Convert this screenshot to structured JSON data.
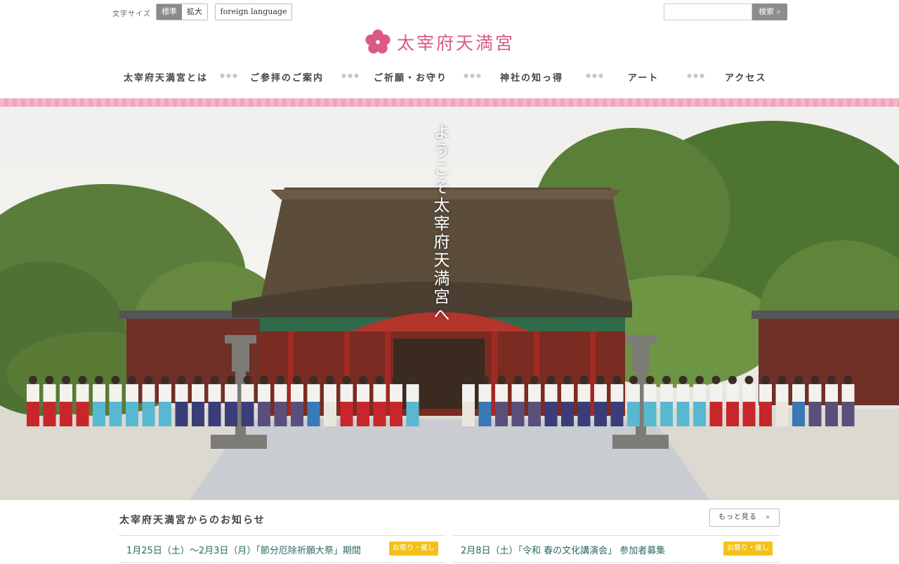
{
  "header": {
    "font_size_label": "文字サイズ",
    "font_size_options": [
      "標準",
      "拡大"
    ],
    "foreign_language_label": "foreign language",
    "search_placeholder": "",
    "search_button_label": "検索"
  },
  "logo": {
    "name": "太宰府天満宮",
    "color": "#d95b83"
  },
  "nav": {
    "items": [
      "太宰府天満宮とは",
      "ご参拝のご案内",
      "ご祈願・お守り",
      "神社の知っ得",
      "アート",
      "アクセス"
    ]
  },
  "hero": {
    "caption": "ようこそ太宰府天満宮へ"
  },
  "news": {
    "heading": "太宰府天満宮からのお知らせ",
    "more_label": "もっと見る",
    "items": [
      {
        "text": "1月25日（土）～2月3日（月）「節分厄除祈願大祭」期間",
        "tag": "お祭り・催し"
      },
      {
        "text": "2月8日（土）「令和 春の文化講演会」 参加者募集",
        "tag": "お祭り・催し"
      }
    ]
  },
  "colors": {
    "accent_pink": "#f4b6c9",
    "tag_yellow": "#f2c21b",
    "news_link": "#2a6a64"
  }
}
